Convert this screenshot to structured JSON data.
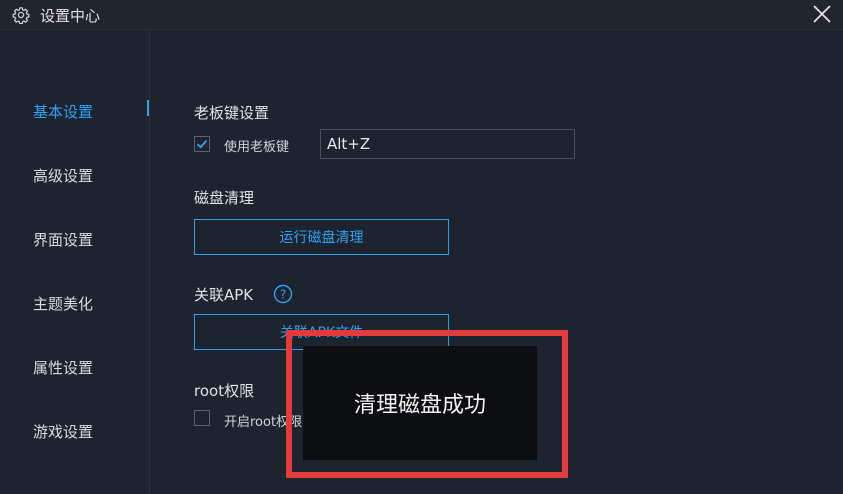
{
  "window": {
    "title": "设置中心"
  },
  "sidebar": {
    "items": [
      {
        "label": "基本设置",
        "active": true
      },
      {
        "label": "高级设置"
      },
      {
        "label": "界面设置"
      },
      {
        "label": "主题美化"
      },
      {
        "label": "属性设置"
      },
      {
        "label": "游戏设置"
      }
    ]
  },
  "boss_key": {
    "section_title": "老板键设置",
    "checkbox_label": "使用老板键",
    "checked": true,
    "value": "Alt+Z"
  },
  "disk_clean": {
    "section_title": "磁盘清理",
    "button_label": "运行磁盘清理"
  },
  "apk": {
    "section_title": "关联APK",
    "button_label": "关联APK文件"
  },
  "root": {
    "section_title": "root权限",
    "checkbox_label": "开启root权限",
    "checked": false
  },
  "toast": {
    "message": "清理磁盘成功"
  },
  "colors": {
    "accent": "#2ea3f2",
    "background": "#1e2330",
    "highlight": "#e53a3a"
  }
}
